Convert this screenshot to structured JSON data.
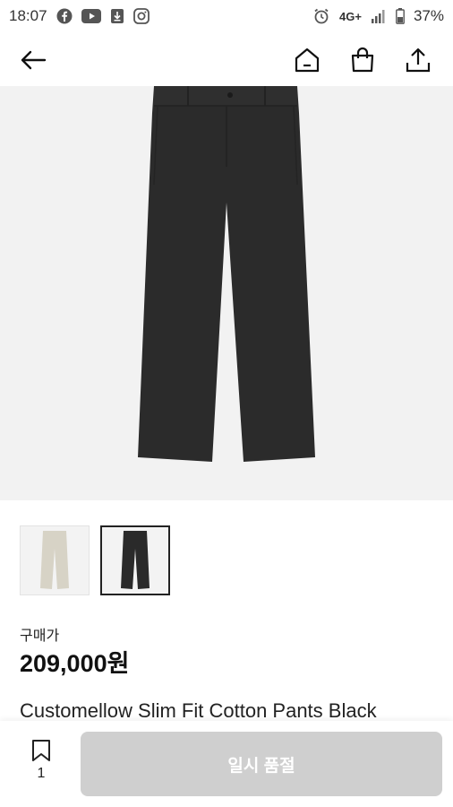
{
  "status_bar": {
    "time": "18:07",
    "battery": "37%",
    "network": "4G+",
    "left_icons": [
      "facebook-icon",
      "youtube-icon",
      "download-icon",
      "instagram-icon"
    ],
    "right_icons": [
      "alarm-icon",
      "signal-icon",
      "battery-icon"
    ]
  },
  "header": {
    "icons": [
      "back-arrow-icon",
      "home-icon",
      "shopping-bag-icon",
      "share-icon"
    ]
  },
  "product": {
    "price_label": "구매가",
    "price": "209,000원",
    "title": "Customellow Slim Fit Cotton Pants Black",
    "thumbnails": [
      {
        "color": "#d7d3c6",
        "selected": false
      },
      {
        "color": "#2a2a2a",
        "selected": true
      }
    ]
  },
  "bottom_bar": {
    "bookmark_count": "1",
    "soldout_label": "일시 품절"
  },
  "colors": {
    "hero_bg": "#f2f2f2",
    "pants": "#2b2b2b",
    "soldout_button": "#cfcfcf"
  }
}
